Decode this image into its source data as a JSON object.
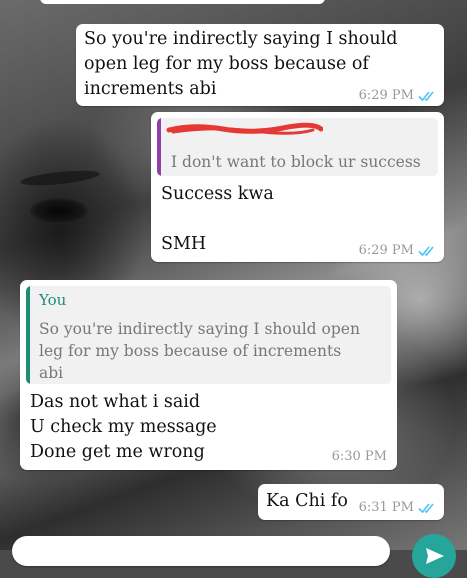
{
  "theme": {
    "accent_outgoing_quote": "#8e3fa8",
    "accent_incoming_quote": "#1f8c7a",
    "author_name_color": "#1f8c7a",
    "read_receipt_color": "#4fc3f7",
    "bubble_bg": "#ffffff",
    "send_button_color": "#26a69a"
  },
  "messages": [
    {
      "direction": "outgoing",
      "text": "So you're indirectly saying I should\nopen leg for my boss because of\nincrements abi",
      "time": "6:29 PM",
      "status": "read"
    },
    {
      "direction": "outgoing",
      "quote": {
        "author": "[redacted]",
        "text": "I don't want to block ur success"
      },
      "text": "Success kwa\n\nSMH",
      "time": "6:29 PM",
      "status": "read"
    },
    {
      "direction": "incoming",
      "quote": {
        "author": "You",
        "text": "So you're indirectly saying I should open\nleg for my boss because of increments\nabi"
      },
      "text": "Das not what i said\nU check my message\nDone get me wrong",
      "time": "6:30 PM"
    },
    {
      "direction": "outgoing",
      "text": "Ka Chi fo",
      "time": "6:31 PM",
      "status": "read"
    }
  ],
  "icons": {
    "read_receipt": "double-check-icon",
    "send": "send-icon"
  }
}
